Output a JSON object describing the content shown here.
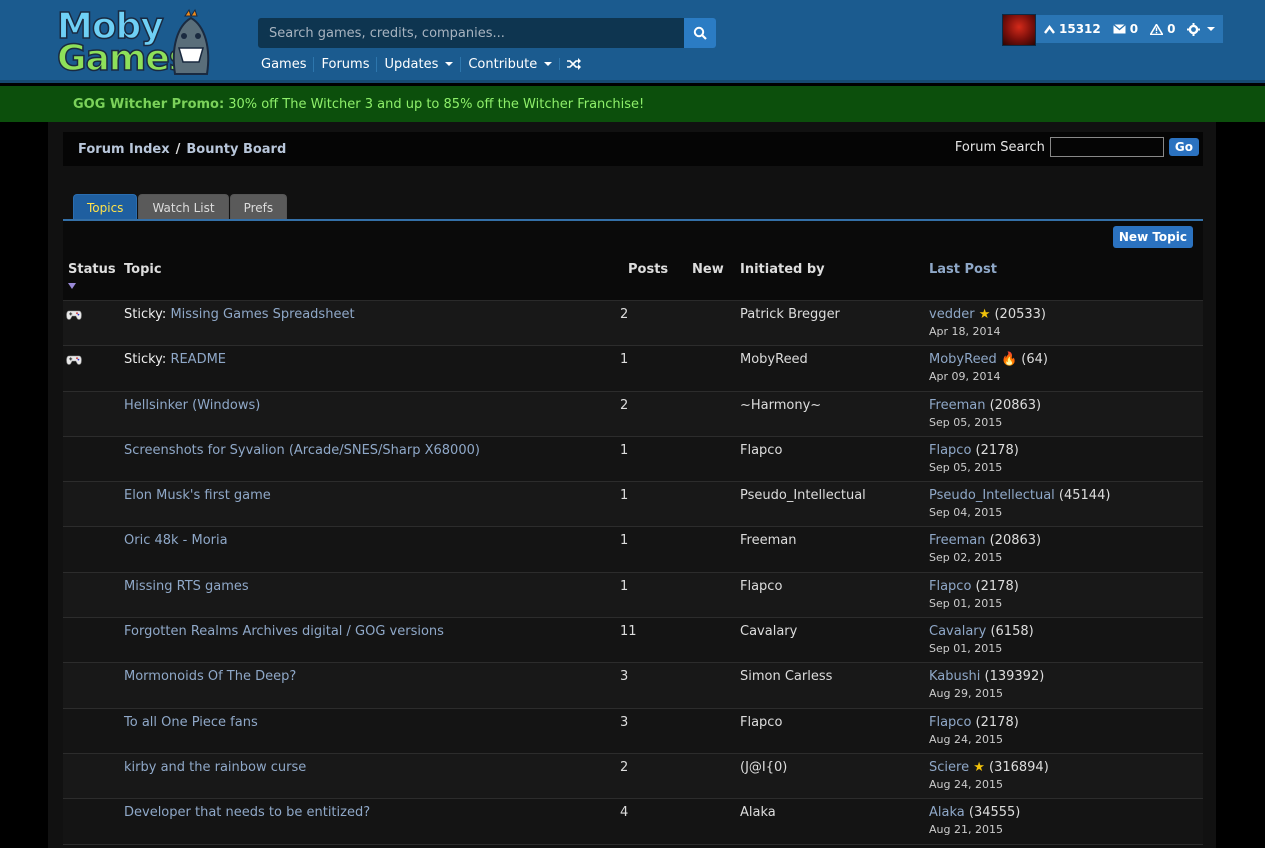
{
  "logo": {
    "line1": "Moby",
    "line2": "Games"
  },
  "search": {
    "placeholder": "Search games, credits, companies..."
  },
  "nav": {
    "games": "Games",
    "forums": "Forums",
    "updates": "Updates",
    "contribute": "Contribute"
  },
  "user": {
    "points": "15312",
    "messages": "0",
    "alerts": "0"
  },
  "promo": {
    "label": "GOG Witcher Promo:",
    "text": "30% off The Witcher 3 and up to 85% off the Witcher Franchise!"
  },
  "breadcrumb": {
    "index": "Forum Index",
    "sep": "/",
    "board": "Bounty Board"
  },
  "forum_search": {
    "label": "Forum Search",
    "go": "Go"
  },
  "tabs": {
    "topics": "Topics",
    "watch": "Watch List",
    "prefs": "Prefs"
  },
  "new_topic": "New Topic",
  "columns": {
    "status": "Status",
    "topic": "Topic",
    "posts": "Posts",
    "new": "New",
    "initiated": "Initiated by",
    "last": "Last Post"
  },
  "rows": [
    {
      "sticky": "Sticky: ",
      "title": "Missing Games Spreadsheet",
      "posts": "2",
      "initiated": "Patrick Bregger",
      "last_user": "vedder",
      "badge": "★",
      "last_count": " (20533)",
      "date": "Apr 18, 2014"
    },
    {
      "sticky": "Sticky: ",
      "title": "README",
      "posts": "1",
      "initiated": "MobyReed",
      "last_user": "MobyReed",
      "badge": "🔥",
      "last_count": " (64)",
      "date": "Apr 09, 2014"
    },
    {
      "sticky": "",
      "title": "Hellsinker (Windows)",
      "posts": "2",
      "initiated": "~Harmony~",
      "last_user": "Freeman",
      "badge": "",
      "last_count": " (20863)",
      "date": "Sep 05, 2015"
    },
    {
      "sticky": "",
      "title": "Screenshots for Syvalion (Arcade/SNES/Sharp X68000)",
      "posts": "1",
      "initiated": "Flapco",
      "last_user": "Flapco",
      "badge": "",
      "last_count": " (2178)",
      "date": "Sep 05, 2015"
    },
    {
      "sticky": "",
      "title": "Elon Musk's first game",
      "posts": "1",
      "initiated": "Pseudo_Intellectual",
      "last_user": "Pseudo_Intellectual",
      "badge": "",
      "last_count": " (45144)",
      "date": "Sep 04, 2015"
    },
    {
      "sticky": "",
      "title": "Oric 48k - Moria",
      "posts": "1",
      "initiated": "Freeman",
      "last_user": "Freeman",
      "badge": "",
      "last_count": " (20863)",
      "date": "Sep 02, 2015"
    },
    {
      "sticky": "",
      "title": "Missing RTS games",
      "posts": "1",
      "initiated": "Flapco",
      "last_user": "Flapco",
      "badge": "",
      "last_count": " (2178)",
      "date": "Sep 01, 2015"
    },
    {
      "sticky": "",
      "title": "Forgotten Realms Archives digital / GOG versions",
      "posts": "11",
      "initiated": "Cavalary",
      "last_user": "Cavalary",
      "badge": "",
      "last_count": " (6158)",
      "date": "Sep 01, 2015"
    },
    {
      "sticky": "",
      "title": "Mormonoids Of The Deep?",
      "posts": "3",
      "initiated": "Simon Carless",
      "last_user": "Kabushi",
      "badge": "",
      "last_count": " (139392)",
      "date": "Aug 29, 2015"
    },
    {
      "sticky": "",
      "title": "To all One Piece fans",
      "posts": "3",
      "initiated": "Flapco",
      "last_user": "Flapco",
      "badge": "",
      "last_count": " (2178)",
      "date": "Aug 24, 2015"
    },
    {
      "sticky": "",
      "title": "kirby and the rainbow curse",
      "posts": "2",
      "initiated": "(J@I{0)",
      "last_user": "Sciere",
      "badge": "★",
      "last_count": " (316894)",
      "date": "Aug 24, 2015"
    },
    {
      "sticky": "",
      "title": "Developer that needs to be entitized?",
      "posts": "4",
      "initiated": "Alaka",
      "last_user": "Alaka",
      "badge": "",
      "last_count": " (34555)",
      "date": "Aug 21, 2015"
    }
  ]
}
